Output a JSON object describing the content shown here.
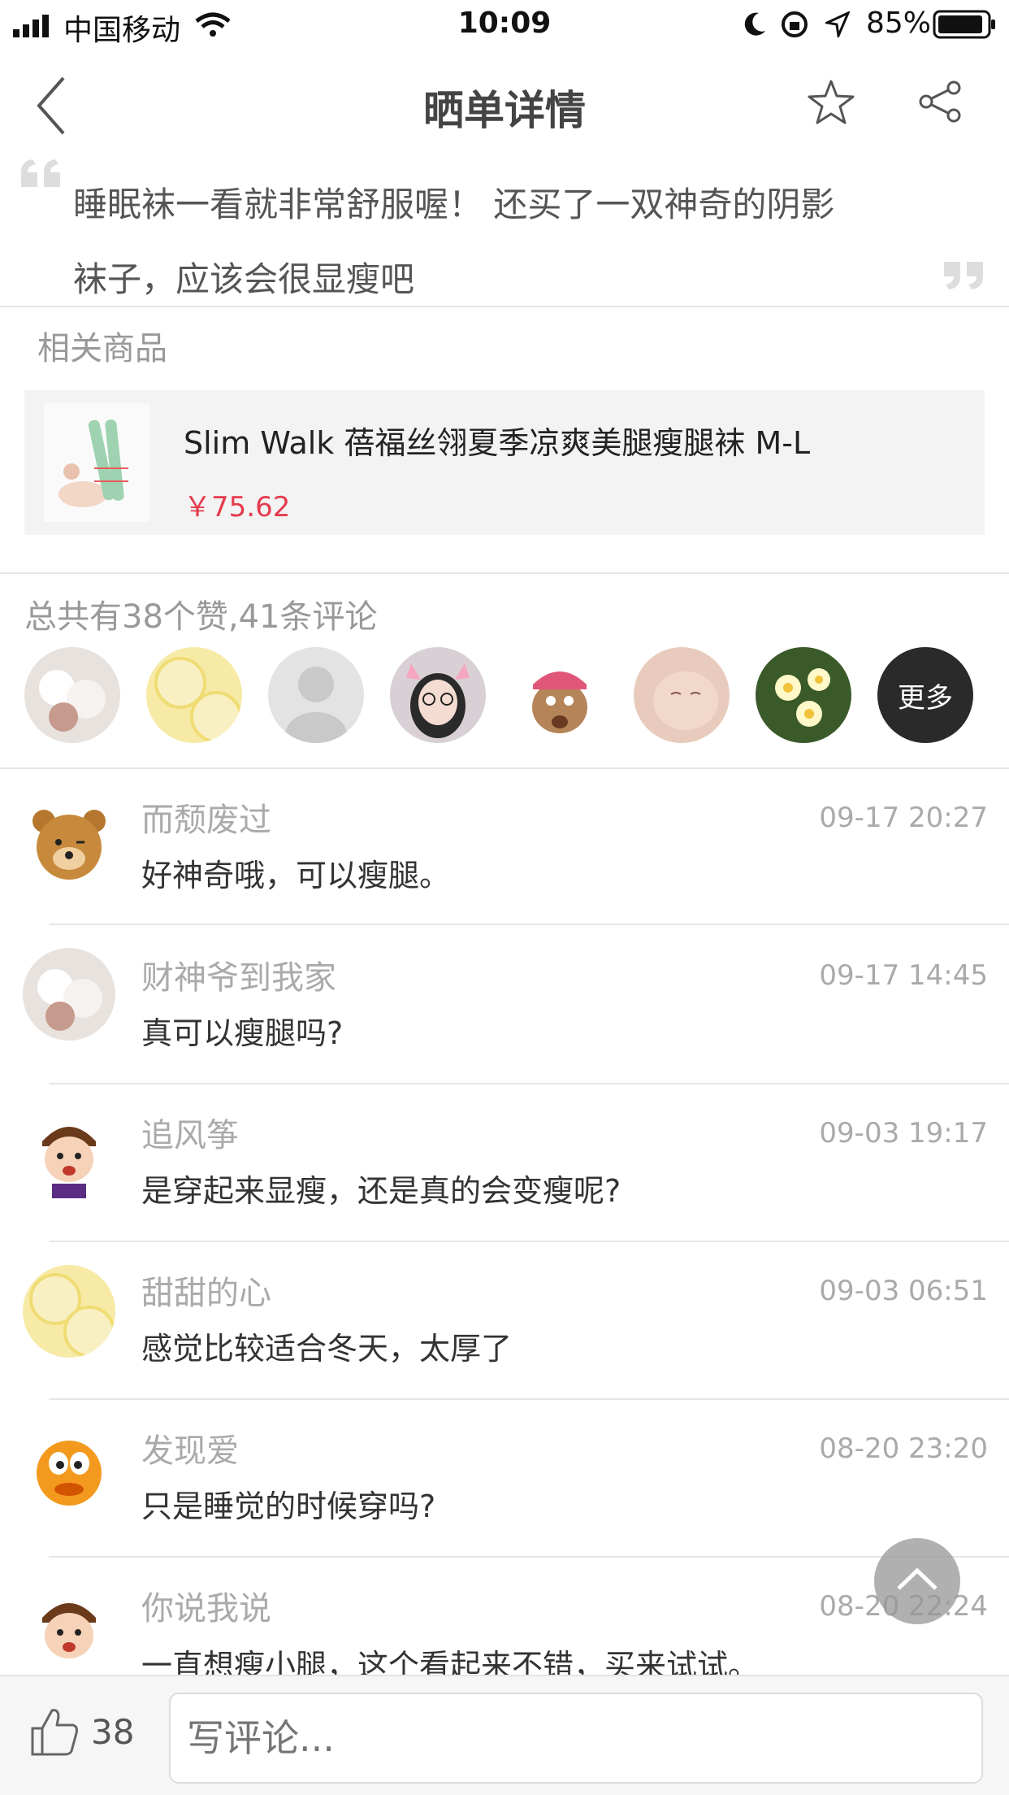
{
  "status_bar": {
    "carrier": "中国移动",
    "time": "10:09",
    "battery": "85%"
  },
  "nav": {
    "title": "晒单详情"
  },
  "post": {
    "text_line1": "睡眠袜一看就非常舒服喔！ 还买了一双神奇的阴影",
    "text_line2": "袜子，应该会很显瘦吧"
  },
  "related": {
    "section_title": "相关商品",
    "product_name": "Slim Walk 蓓福丝翎夏季凉爽美腿瘦腿袜 M-L",
    "price": "￥75.62"
  },
  "likes": {
    "summary": "总共有38个赞,41条评论",
    "more_label": "更多"
  },
  "comments": [
    {
      "name": "而颓废过",
      "time": "09-17 20:27",
      "text": "好神奇哦，可以瘦腿。"
    },
    {
      "name": "财神爷到我家",
      "time": "09-17 14:45",
      "text": "真可以瘦腿吗?"
    },
    {
      "name": "追风筝",
      "time": "09-03 19:17",
      "text": "是穿起来显瘦，还是真的会变瘦呢?"
    },
    {
      "name": "甜甜的心",
      "time": "09-03 06:51",
      "text": "感觉比较适合冬天，太厚了"
    },
    {
      "name": "发现爱",
      "time": "08-20 23:20",
      "text": "只是睡觉的时候穿吗?"
    },
    {
      "name": "你说我说",
      "time": "08-20 22:24",
      "text": "一直想瘦小腿，这个看起来不错，买来试试。"
    }
  ],
  "bottom": {
    "like_count": "38",
    "comment_placeholder": "写评论..."
  },
  "colors": {
    "price": "#e63a4d",
    "secondary_text": "#999999"
  }
}
